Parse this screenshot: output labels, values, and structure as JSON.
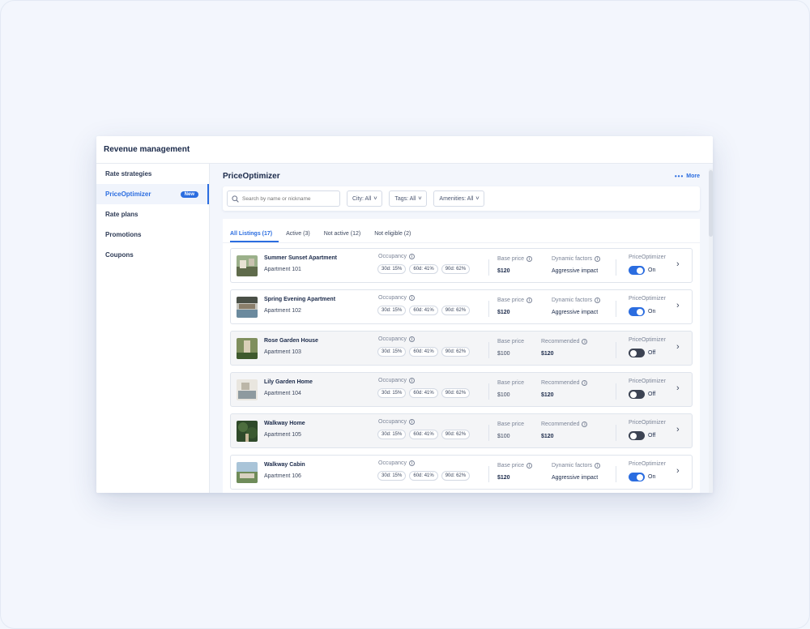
{
  "app": {
    "title": "Revenue management"
  },
  "sidebar": {
    "items": [
      {
        "label": "Rate strategies",
        "active": false
      },
      {
        "label": "PriceOptimizer",
        "active": true,
        "badge": "New"
      },
      {
        "label": "Rate plans",
        "active": false
      },
      {
        "label": "Promotions",
        "active": false
      },
      {
        "label": "Coupons",
        "active": false
      }
    ]
  },
  "main": {
    "title": "PriceOptimizer",
    "more_label": "More",
    "search": {
      "placeholder": "Search by name or nickname",
      "value": ""
    },
    "filters": [
      {
        "label": "City: All"
      },
      {
        "label": "Tags: All"
      },
      {
        "label": "Amenities: All"
      }
    ],
    "tabs": [
      {
        "label": "All Listings (17)",
        "active": true
      },
      {
        "label": "Active (3)",
        "active": false
      },
      {
        "label": "Not active (12)",
        "active": false
      },
      {
        "label": "Not eligible (2)",
        "active": false
      }
    ],
    "occupancy_label": "Occupancy",
    "base_price_label": "Base price",
    "dynamic_factors_label": "Dynamic factors",
    "recommended_label": "Recommended",
    "priceoptimizer_label": "PriceOptimizer",
    "listings": [
      {
        "name": "Summer Sunset Apartment",
        "unit": "Apartment 101",
        "occ30": "30d: 15%",
        "occ60": "60d: 41%",
        "occ90": "90d: 62%",
        "base_price": "$120",
        "factor_type": "dynamic",
        "factor_value": "Aggressive impact",
        "optimizer": "On"
      },
      {
        "name": "Spring Evening Apartment",
        "unit": "Apartment 102",
        "occ30": "30d: 15%",
        "occ60": "60d: 41%",
        "occ90": "90d: 62%",
        "base_price": "$120",
        "factor_type": "dynamic",
        "factor_value": "Aggressive impact",
        "optimizer": "On"
      },
      {
        "name": "Rose Garden House",
        "unit": "Apartment 103",
        "occ30": "30d: 15%",
        "occ60": "60d: 41%",
        "occ90": "90d: 62%",
        "base_price": "$100",
        "factor_type": "recommended",
        "factor_value": "$120",
        "optimizer": "Off"
      },
      {
        "name": "Lily Garden Home",
        "unit": "Apartment 104",
        "occ30": "30d: 15%",
        "occ60": "60d: 41%",
        "occ90": "90d: 62%",
        "base_price": "$100",
        "factor_type": "recommended",
        "factor_value": "$120",
        "optimizer": "Off"
      },
      {
        "name": "Walkway Home",
        "unit": "Apartment 105",
        "occ30": "30d: 15%",
        "occ60": "60d: 41%",
        "occ90": "90d: 62%",
        "base_price": "$100",
        "factor_type": "recommended",
        "factor_value": "$120",
        "optimizer": "Off"
      },
      {
        "name": "Walkway Cabin",
        "unit": "Apartment 106",
        "occ30": "30d: 15%",
        "occ60": "60d: 41%",
        "occ90": "90d: 62%",
        "base_price": "$120",
        "factor_type": "dynamic",
        "factor_value": "Aggressive impact",
        "optimizer": "On"
      }
    ]
  },
  "colors": {
    "accent": "#2b6de0",
    "toggle_off": "#3c4353",
    "inactive_row": "#f4f5f7"
  },
  "icons": {
    "search": "search-icon",
    "info": "info-icon",
    "chevron_down": "chevron-down-icon",
    "chevron_right": "chevron-right-icon",
    "more": "more-dots-icon"
  }
}
